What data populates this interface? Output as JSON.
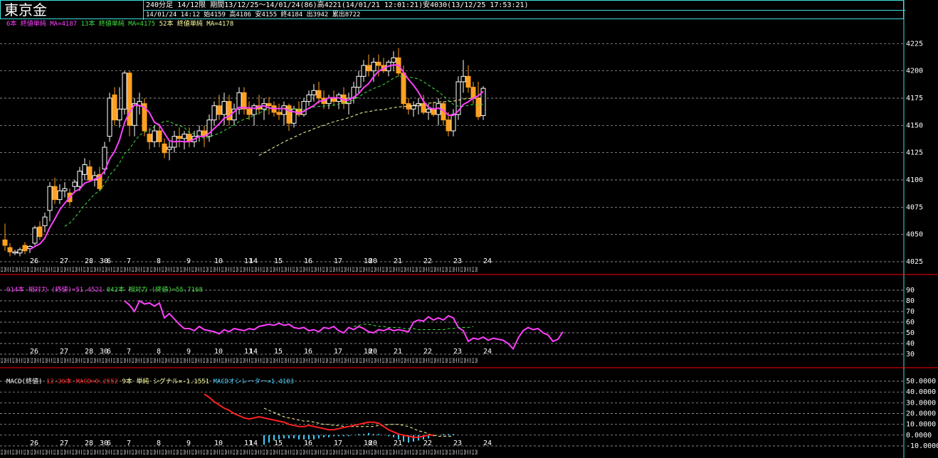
{
  "title": "東京金",
  "info": {
    "line1": "240分足 14/12限 期間13/12/25～14/01/24(86)高4221(14/01/21 12:01:21)安4030(13/12/25 17:53:21)",
    "line2": "14/01/24 14:12 始4159 高4186 安4155 終4184 出3942 累出8722"
  },
  "colors": {
    "background": "#000000",
    "border": "#3fe0e0",
    "candle_up": "#ffffff",
    "candle_down": "#ffa020",
    "ma6": "#ff40ff",
    "ma13": "#40e040",
    "ma52": "#ffffa0",
    "rsi14": "#ff40ff",
    "rsi42": "#40e040",
    "macd": "#ff2020",
    "signal": "#ffffa0",
    "osc": "#40d0ff",
    "divider": "#ff0000"
  },
  "legends": {
    "price": [
      {
        "text": "6本 終値単純 MA=4187",
        "color": "#ff40ff"
      },
      {
        "text": " 13本 終値単純 MA=4175",
        "color": "#40e040"
      },
      {
        "text": " 52本 終値単純 MA=4178",
        "color": "#ffffa0"
      }
    ],
    "rsi": [
      {
        "text": "014本 相対力 (終値)=51.4521",
        "color": "#ff40ff"
      },
      {
        "text": " 042本 相対力 (終値)=55.7168",
        "color": "#40e040"
      }
    ],
    "macd": [
      {
        "text": "MACD(終値)",
        "color": "#ffffff"
      },
      {
        "text": " 12-26本 MACD=0.2552",
        "color": "#ff2020"
      },
      {
        "text": " 9本 単純 シグナル=-1.1551",
        "color": "#ffffa0"
      },
      {
        "text": " MACDオシレーター=1.4103",
        "color": "#40d0ff"
      }
    ]
  },
  "chart_data": [
    {
      "type": "candlestick",
      "name": "price",
      "ylim": [
        4025,
        4235
      ],
      "yticks": [
        "4225",
        "4200",
        "4175",
        "4150",
        "4125",
        "4100",
        "4075",
        "4050",
        "4025"
      ],
      "ytick_values": [
        4225,
        4200,
        4175,
        4150,
        4125,
        4100,
        4075,
        4050,
        4025
      ],
      "grid": true,
      "dates": [
        "26",
        "27",
        "28",
        "30",
        "6",
        "7",
        "8",
        "9",
        "10",
        "11",
        "14",
        "15",
        "16",
        "17",
        "18",
        "20",
        "21",
        "22",
        "23",
        "24"
      ],
      "date_bar_index": [
        3,
        9,
        14,
        17,
        18,
        22,
        28,
        34,
        40,
        46,
        47,
        52,
        58,
        64,
        70,
        71,
        76,
        82,
        88,
        94
      ],
      "session_labels_row": "12 20 0 8 12 20 0 8 12 20",
      "candles": [
        [
          4045,
          4060,
          4035,
          4040
        ],
        [
          4038,
          4042,
          4030,
          4034
        ],
        [
          4033,
          4036,
          4031,
          4034
        ],
        [
          4033,
          4038,
          4030,
          4036
        ],
        [
          4040,
          4043,
          4032,
          4035
        ],
        [
          4037,
          4040,
          4033,
          4039
        ],
        [
          4042,
          4058,
          4040,
          4056
        ],
        [
          4057,
          4062,
          4045,
          4048
        ],
        [
          4058,
          4070,
          4052,
          4066
        ],
        [
          4072,
          4098,
          4062,
          4094
        ],
        [
          4094,
          4102,
          4078,
          4082
        ],
        [
          4082,
          4096,
          4078,
          4090
        ],
        [
          4090,
          4098,
          4084,
          4092
        ],
        [
          4088,
          4092,
          4076,
          4080
        ],
        [
          4094,
          4100,
          4088,
          4098
        ],
        [
          4094,
          4112,
          4090,
          4108
        ],
        [
          4105,
          4120,
          4100,
          4114
        ],
        [
          4112,
          4118,
          4098,
          4100
        ],
        [
          4100,
          4108,
          4094,
          4104
        ],
        [
          4105,
          4112,
          4090,
          4092
        ],
        [
          4110,
          4135,
          4105,
          4130
        ],
        [
          4140,
          4180,
          4135,
          4175
        ],
        [
          4178,
          4185,
          4150,
          4155
        ],
        [
          4155,
          4185,
          4148,
          4165
        ],
        [
          4165,
          4200,
          4160,
          4198
        ],
        [
          4198,
          4200,
          4140,
          4150
        ],
        [
          4150,
          4175,
          4140,
          4170
        ],
        [
          4168,
          4180,
          4160,
          4172
        ],
        [
          4170,
          4175,
          4140,
          4145
        ],
        [
          4142,
          4148,
          4128,
          4135
        ],
        [
          4135,
          4150,
          4130,
          4145
        ],
        [
          4145,
          4150,
          4130,
          4135
        ],
        [
          4133,
          4138,
          4120,
          4125
        ],
        [
          4128,
          4135,
          4118,
          4130
        ],
        [
          4130,
          4145,
          4125,
          4140
        ],
        [
          4140,
          4148,
          4130,
          4138
        ],
        [
          4138,
          4145,
          4128,
          4142
        ],
        [
          4142,
          4148,
          4130,
          4135
        ],
        [
          4135,
          4145,
          4130,
          4140
        ],
        [
          4140,
          4150,
          4135,
          4145
        ],
        [
          4145,
          4150,
          4130,
          4140
        ],
        [
          4140,
          4160,
          4135,
          4155
        ],
        [
          4155,
          4172,
          4150,
          4168
        ],
        [
          4168,
          4178,
          4155,
          4160
        ],
        [
          4160,
          4180,
          4150,
          4172
        ],
        [
          4172,
          4178,
          4150,
          4155
        ],
        [
          4155,
          4170,
          4150,
          4165
        ],
        [
          4165,
          4185,
          4160,
          4180
        ],
        [
          4180,
          4185,
          4160,
          4165
        ],
        [
          4165,
          4172,
          4155,
          4160
        ],
        [
          4160,
          4170,
          4150,
          4168
        ],
        [
          4168,
          4178,
          4160,
          4165
        ],
        [
          4165,
          4175,
          4155,
          4170
        ],
        [
          4170,
          4176,
          4160,
          4168
        ],
        [
          4168,
          4172,
          4158,
          4162
        ],
        [
          4162,
          4170,
          4155,
          4160
        ],
        [
          4160,
          4172,
          4150,
          4168
        ],
        [
          4168,
          4170,
          4145,
          4152
        ],
        [
          4152,
          4168,
          4148,
          4165
        ],
        [
          4165,
          4172,
          4158,
          4160
        ],
        [
          4160,
          4175,
          4158,
          4172
        ],
        [
          4172,
          4182,
          4168,
          4178
        ],
        [
          4178,
          4188,
          4172,
          4182
        ],
        [
          4182,
          4190,
          4170,
          4175
        ],
        [
          4175,
          4182,
          4165,
          4170
        ],
        [
          4170,
          4178,
          4165,
          4175
        ],
        [
          4175,
          4182,
          4168,
          4172
        ],
        [
          4172,
          4180,
          4165,
          4178
        ],
        [
          4178,
          4185,
          4165,
          4170
        ],
        [
          4170,
          4180,
          4160,
          4175
        ],
        [
          4175,
          4190,
          4170,
          4185
        ],
        [
          4185,
          4200,
          4180,
          4195
        ],
        [
          4195,
          4210,
          4190,
          4205
        ],
        [
          4205,
          4215,
          4195,
          4200
        ],
        [
          4200,
          4212,
          4190,
          4208
        ],
        [
          4208,
          4215,
          4195,
          4205
        ],
        [
          4205,
          4212,
          4198,
          4200
        ],
        [
          4200,
          4210,
          4195,
          4208
        ],
        [
          4208,
          4218,
          4200,
          4212
        ],
        [
          4212,
          4221,
          4195,
          4198
        ],
        [
          4198,
          4205,
          4165,
          4170
        ],
        [
          4170,
          4175,
          4160,
          4165
        ],
        [
          4165,
          4172,
          4158,
          4168
        ],
        [
          4168,
          4175,
          4160,
          4170
        ],
        [
          4170,
          4178,
          4160,
          4162
        ],
        [
          4162,
          4170,
          4155,
          4165
        ],
        [
          4165,
          4172,
          4158,
          4160
        ],
        [
          4160,
          4175,
          4150,
          4170
        ],
        [
          4170,
          4172,
          4150,
          4155
        ],
        [
          4155,
          4162,
          4140,
          4145
        ],
        [
          4145,
          4165,
          4140,
          4160
        ],
        [
          4160,
          4195,
          4155,
          4190
        ],
        [
          4190,
          4210,
          4180,
          4195
        ],
        [
          4195,
          4205,
          4180,
          4185
        ],
        [
          4185,
          4190,
          4170,
          4175
        ],
        [
          4175,
          4190,
          4155,
          4158
        ],
        [
          4159,
          4186,
          4155,
          4184
        ]
      ]
    },
    {
      "type": "line",
      "name": "rsi",
      "ylim": [
        30,
        90
      ],
      "yticks": [
        "90",
        "80",
        "70",
        "60",
        "50",
        "40",
        "30"
      ],
      "ytick_values": [
        90,
        80,
        70,
        60,
        50,
        40,
        30
      ],
      "grid": true,
      "series": [
        {
          "name": "014本 相対力 (終値)",
          "start": 24,
          "values": [
            80,
            76,
            70,
            80,
            77,
            78,
            75,
            78,
            64,
            68,
            63,
            58,
            54,
            54,
            52,
            56,
            53,
            52,
            51,
            49,
            53,
            51,
            54,
            53,
            52,
            54,
            53,
            56,
            57,
            58,
            57,
            59,
            57,
            58,
            55,
            54,
            55,
            52,
            53,
            51,
            55,
            54,
            56,
            52,
            50,
            55,
            53,
            56,
            54,
            51,
            50,
            53,
            52,
            54,
            52,
            53,
            52,
            51,
            60,
            62,
            61,
            65,
            62,
            64,
            62,
            66,
            64,
            55,
            52,
            42,
            45,
            44,
            46,
            43,
            45,
            44,
            43,
            40,
            35,
            45,
            52,
            55,
            53,
            54,
            50,
            48,
            42,
            44,
            51
          ]
        },
        {
          "name": "042本 相対力 (終値)",
          "start": 70,
          "values": [
            56,
            57,
            58,
            58,
            57,
            56,
            56,
            55,
            55,
            55,
            54,
            54,
            54,
            53,
            53,
            53,
            53,
            53,
            53,
            54,
            54,
            55,
            55,
            55,
            56
          ]
        }
      ]
    },
    {
      "type": "line",
      "name": "macd",
      "ylim": [
        -10,
        50
      ],
      "yticks": [
        "50.0000",
        "40.0000",
        "30.0000",
        "20.0000",
        "10.0000",
        "0.0000",
        "-10.0000"
      ],
      "ytick_values": [
        50,
        40,
        30,
        20,
        10,
        0,
        -10
      ],
      "grid": true,
      "series": [
        {
          "name": "MACD",
          "start": 40,
          "values": [
            38,
            35,
            31,
            28,
            25,
            23,
            20,
            18,
            16,
            15,
            16,
            17,
            16,
            15,
            14,
            13,
            12,
            10,
            9,
            8,
            8,
            9,
            8,
            7,
            6,
            5,
            5,
            6,
            7,
            8,
            9,
            10,
            11,
            12,
            12,
            11,
            8,
            5,
            3,
            1,
            0,
            -1,
            -2,
            -2,
            -1,
            0,
            0
          ]
        },
        {
          "name": "シグナル",
          "start": 52,
          "values": [
            25,
            23,
            21,
            19,
            17,
            16,
            15,
            14,
            13,
            13,
            12,
            11,
            10,
            10,
            9,
            9,
            8,
            8,
            8,
            8,
            8,
            8,
            8,
            9,
            9,
            10,
            10,
            10,
            9,
            8,
            6,
            4,
            3,
            1,
            0,
            -1,
            -1,
            -1,
            -1
          ]
        },
        {
          "name": "MACDオシレーター",
          "start": 52,
          "type": "histogram",
          "values": [
            -9,
            -7,
            -5,
            -4,
            -3,
            -3,
            -3,
            -4,
            -4,
            -4,
            -4,
            -3,
            -2,
            -2,
            -1,
            -1,
            -1,
            -1,
            0,
            1,
            1,
            2,
            1,
            1,
            0,
            -1,
            -2,
            -4,
            -6,
            -7,
            -6,
            -5,
            -4,
            -3,
            -1,
            0,
            1,
            1,
            1
          ]
        }
      ]
    }
  ]
}
